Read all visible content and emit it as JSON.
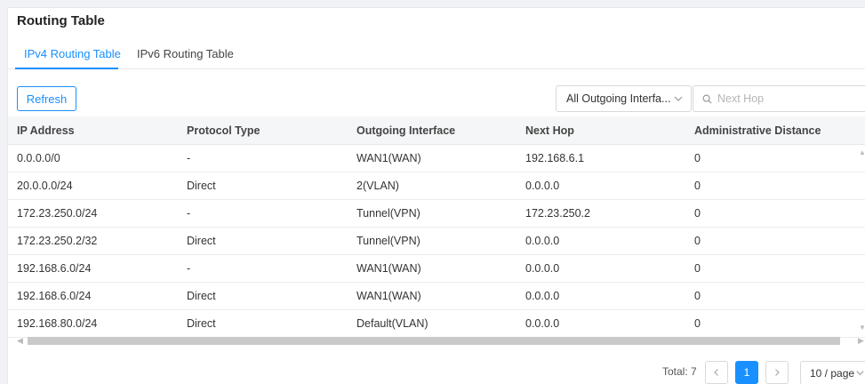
{
  "page": {
    "title": "Routing Table"
  },
  "tabs": [
    {
      "label": "IPv4 Routing Table",
      "active": true
    },
    {
      "label": "IPv6 Routing Table",
      "active": false
    }
  ],
  "toolbar": {
    "refresh_label": "Refresh",
    "interface_filter": {
      "selected": "All Outgoing Interfa..."
    },
    "search": {
      "placeholder": "Next Hop",
      "value": ""
    }
  },
  "table": {
    "columns": [
      "IP Address",
      "Protocol Type",
      "Outgoing Interface",
      "Next Hop",
      "Administrative Distance"
    ],
    "rows": [
      [
        "0.0.0.0/0",
        "-",
        "WAN1(WAN)",
        "192.168.6.1",
        "0"
      ],
      [
        "20.0.0.0/24",
        "Direct",
        "2(VLAN)",
        "0.0.0.0",
        "0"
      ],
      [
        "172.23.250.0/24",
        "-",
        "Tunnel(VPN)",
        "172.23.250.2",
        "0"
      ],
      [
        "172.23.250.2/32",
        "Direct",
        "Tunnel(VPN)",
        "0.0.0.0",
        "0"
      ],
      [
        "192.168.6.0/24",
        "-",
        "WAN1(WAN)",
        "0.0.0.0",
        "0"
      ],
      [
        "192.168.6.0/24",
        "Direct",
        "WAN1(WAN)",
        "0.0.0.0",
        "0"
      ],
      [
        "192.168.80.0/24",
        "Direct",
        "Default(VLAN)",
        "0.0.0.0",
        "0"
      ]
    ]
  },
  "pagination": {
    "total_label": "Total: 7",
    "current_page": "1",
    "page_size": "10 / page"
  },
  "colors": {
    "accent": "#1890ff",
    "header_bg": "#f5f6f8"
  }
}
